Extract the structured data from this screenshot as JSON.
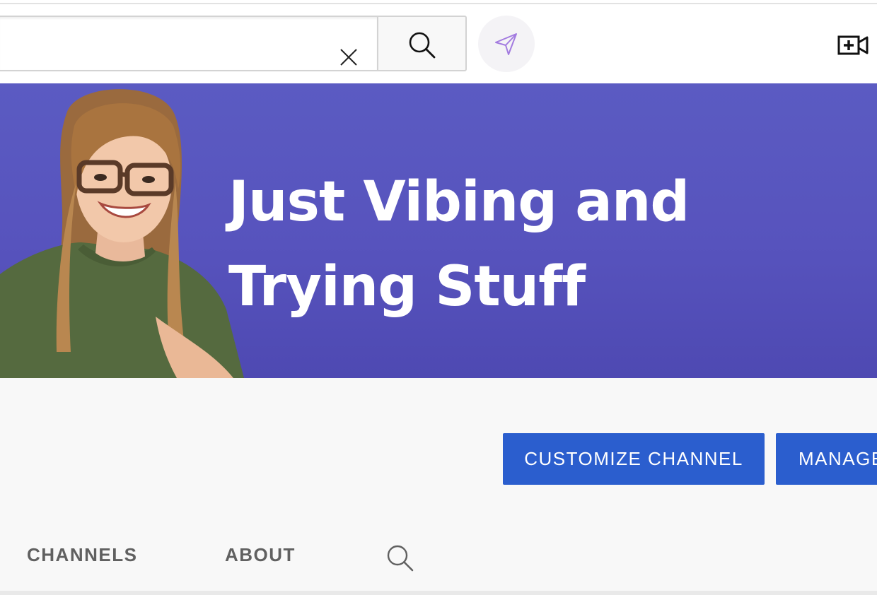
{
  "header": {
    "search": {
      "value": "",
      "placeholder": ""
    },
    "icons": {
      "clear": "close-icon",
      "search": "search-icon",
      "send": "send-icon",
      "create": "video-add-icon"
    },
    "send_accent": "#a37be0"
  },
  "banner": {
    "line1": "Just Vibing and",
    "line2": "Trying Stuff",
    "background": "#5b57c0"
  },
  "channel": {
    "customize_label": "CUSTOMIZE CHANNEL",
    "manage_label": "MANAGE",
    "button_color": "#2b5ece"
  },
  "tabs": {
    "channels_label": "CHANNELS",
    "about_label": "ABOUT",
    "search_icon": "search-icon"
  }
}
